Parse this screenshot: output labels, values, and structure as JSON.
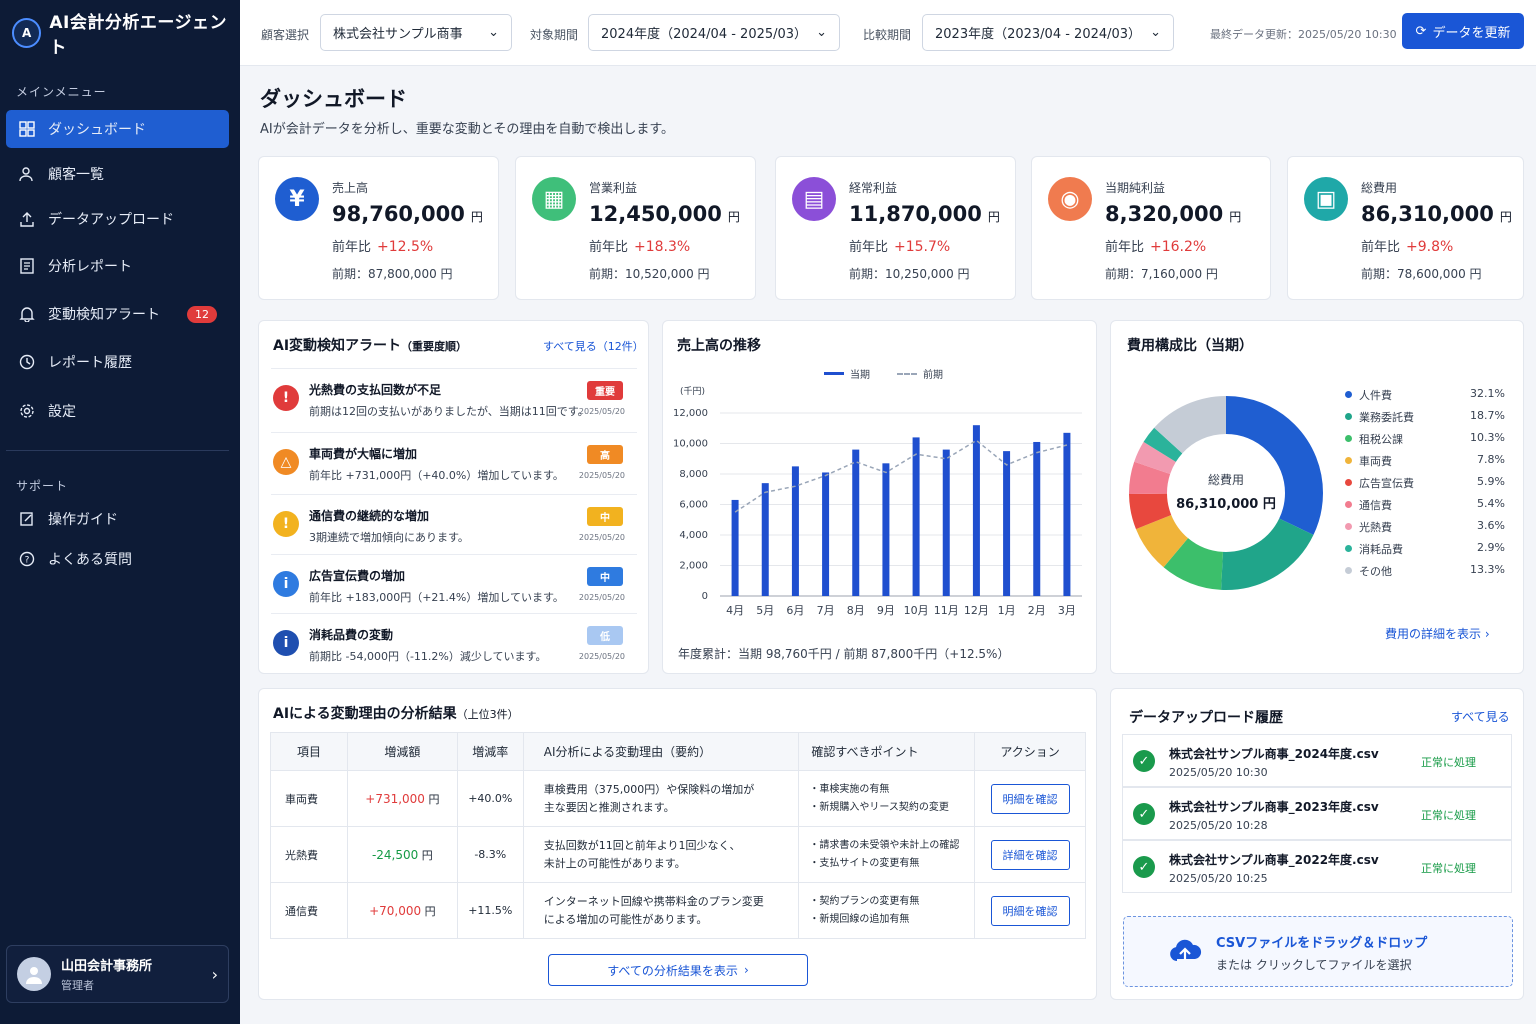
{
  "app": {
    "title": "AI会計分析エージェント",
    "logo_mark": "A"
  },
  "sidebar": {
    "main_section": "メインメニュー",
    "items": [
      {
        "label": "ダッシュボード",
        "icon": "dashboard-icon",
        "active": true
      },
      {
        "label": "顧客一覧",
        "icon": "users-icon"
      },
      {
        "label": "データアップロード",
        "icon": "upload-icon"
      },
      {
        "label": "分析レポート",
        "icon": "report-icon"
      },
      {
        "label": "変動検知アラート",
        "icon": "bell-icon",
        "badge": "12"
      },
      {
        "label": "レポート履歴",
        "icon": "history-icon"
      },
      {
        "label": "設定",
        "icon": "gear-icon"
      }
    ],
    "support_section": "サポート",
    "support_items": [
      {
        "label": "操作ガイド",
        "icon": "guide-icon"
      },
      {
        "label": "よくある質問",
        "icon": "help-icon"
      }
    ],
    "user": {
      "name": "山田会計事務所",
      "role": "管理者"
    }
  },
  "topbar": {
    "client_label": "顧客選択",
    "client_value": "株式会社サンプル商事",
    "period_label": "対象期間",
    "period_value": "2024年度（2024/04 - 2025/03）",
    "compare_label": "比較期間",
    "compare_value": "2023年度（2023/04 - 2024/03）",
    "last_updated": "最終データ更新：2025/05/20 10:30",
    "refresh_label": "データを更新"
  },
  "page": {
    "title": "ダッシュボード",
    "subtitle": "AIが会計データを分析し、重要な変動とその理由を自動で検出します。"
  },
  "kpis": [
    {
      "title": "売上高",
      "value": "98,760,000",
      "unit": "円",
      "yoy_label": "前年比",
      "yoy": "+12.5%",
      "prev": "前期：87,800,000 円",
      "color": "#1f5ed1",
      "icon": "yen-icon",
      "glyph": "¥"
    },
    {
      "title": "営業利益",
      "value": "12,450,000",
      "unit": "円",
      "yoy_label": "前年比",
      "yoy": "+18.3%",
      "prev": "前期：10,520,000 円",
      "color": "#3fbf7a",
      "icon": "building-icon",
      "glyph": "▦"
    },
    {
      "title": "経常利益",
      "value": "11,870,000",
      "unit": "円",
      "yoy_label": "前年比",
      "yoy": "+15.7%",
      "prev": "前期：10,250,000 円",
      "color": "#8b4fd8",
      "icon": "chart-icon",
      "glyph": "▤"
    },
    {
      "title": "当期純利益",
      "value": "8,320,000",
      "unit": "円",
      "yoy_label": "前年比",
      "yoy": "+16.2%",
      "prev": "前期：7,160,000 円",
      "color": "#f07b4f",
      "icon": "money-bag-icon",
      "glyph": "◉"
    },
    {
      "title": "総費用",
      "value": "86,310,000",
      "unit": "円",
      "yoy_label": "前年比",
      "yoy": "+9.8%",
      "prev": "前期：78,600,000 円",
      "color": "#1fa8a8",
      "icon": "receipt-icon",
      "glyph": "▣"
    }
  ],
  "alerts": {
    "title": "AI変動検知アラート",
    "title_sub": "（重要度順）",
    "view_all": "すべて見る（12件）",
    "items": [
      {
        "title": "光熱費の支払回数が不足",
        "desc": "前期は12回の支払いがありましたが、当期は11回です。",
        "badge": "重要",
        "badge_color": "#e03b3b",
        "date": "2025/05/20",
        "icon_color": "#e03b3b",
        "glyph": "!",
        "icon": "error-icon"
      },
      {
        "title": "車両費が大幅に増加",
        "desc": "前年比 +731,000円（+40.0%）増加しています。",
        "badge": "高",
        "badge_color": "#f08a24",
        "date": "2025/05/20",
        "icon_color": "#f08a24",
        "glyph": "△",
        "icon": "warning-icon"
      },
      {
        "title": "通信費の継続的な増加",
        "desc": "3期連続で増加傾向にあります。",
        "badge": "中",
        "badge_color": "#f2b21f",
        "date": "2025/05/20",
        "icon_color": "#f2b21f",
        "glyph": "!",
        "icon": "caution-icon"
      },
      {
        "title": "広告宣伝費の増加",
        "desc": "前年比 +183,000円（+21.4%）増加しています。",
        "badge": "中",
        "badge_color": "#2f7be0",
        "date": "2025/05/20",
        "icon_color": "#2f7be0",
        "glyph": "i",
        "icon": "info-icon"
      },
      {
        "title": "消耗品費の変動",
        "desc": "前期比 -54,000円（-11.2%）減少しています。",
        "badge": "低",
        "badge_color": "#a9c8f2",
        "date": "2025/05/20",
        "icon_color": "#1f4fb0",
        "glyph": "i",
        "icon": "info-icon"
      }
    ]
  },
  "sales_chart": {
    "title": "売上高の推移",
    "legend_current": "当期",
    "legend_prev": "前期",
    "total_text": "年度累計：当期 98,760千円 / 前期 87,800千円（+12.5%）"
  },
  "chart_data": [
    {
      "type": "bar",
      "title": "売上高の推移",
      "ylabel": "(千円)",
      "ylim": [
        0,
        12000
      ],
      "yticks": [
        "0",
        "2,000",
        "4,000",
        "6,000",
        "8,000",
        "10,000",
        "12,000"
      ],
      "categories": [
        "4月",
        "5月",
        "6月",
        "7月",
        "8月",
        "9月",
        "10月",
        "11月",
        "12月",
        "1月",
        "2月",
        "3月"
      ],
      "series": [
        {
          "name": "当期",
          "type": "bar",
          "color": "#1f4fcf",
          "values": [
            6300,
            7400,
            8500,
            8100,
            9600,
            8700,
            10400,
            9600,
            11200,
            9500,
            10100,
            10700
          ]
        },
        {
          "name": "前期",
          "type": "line",
          "style": "dashed",
          "color": "#9aa6b8",
          "values": [
            5500,
            6800,
            7200,
            7900,
            8800,
            8100,
            9300,
            9000,
            10200,
            8600,
            9400,
            9900
          ]
        }
      ],
      "grid": true,
      "legend": "top-center"
    },
    {
      "type": "pie",
      "title": "費用構成比（当期）",
      "center_label": "総費用",
      "center_value": "86,310,000 円",
      "slices": [
        {
          "name": "人件費",
          "pct": "32.1%",
          "value": 32.1,
          "color": "#1f5ed1"
        },
        {
          "name": "業務委託費",
          "pct": "18.7%",
          "value": 18.7,
          "color": "#20a58a"
        },
        {
          "name": "租税公課",
          "pct": "10.3%",
          "value": 10.3,
          "color": "#3cbf6b"
        },
        {
          "name": "車両費",
          "pct": "7.8%",
          "value": 7.8,
          "color": "#f0b43a"
        },
        {
          "name": "広告宣伝費",
          "pct": "5.9%",
          "value": 5.9,
          "color": "#e8483e"
        },
        {
          "name": "通信費",
          "pct": "5.4%",
          "value": 5.4,
          "color": "#f27c8f"
        },
        {
          "name": "光熱費",
          "pct": "3.6%",
          "value": 3.6,
          "color": "#f29ab0"
        },
        {
          "name": "消耗品費",
          "pct": "2.9%",
          "value": 2.9,
          "color": "#2bb39b"
        },
        {
          "name": "その他",
          "pct": "13.3%",
          "value": 13.3,
          "color": "#c5ccd6"
        }
      ],
      "legend": "right"
    }
  ],
  "cost_chart": {
    "title": "費用構成比（当期）",
    "detail_link": "費用の詳細を表示"
  },
  "analysis": {
    "title": "AIによる変動理由の分析結果",
    "title_sub": "（上位3件）",
    "headers": [
      "項目",
      "増減額",
      "増減率",
      "AI分析による変動理由（要約）",
      "確認すべきポイント",
      "アクション"
    ],
    "rows": [
      {
        "item": "車両費",
        "amount": "+731,000",
        "unit": "円",
        "rate": "+40.0%",
        "trend": "up",
        "reason1": "車検費用（375,000円）や保険料の増加が",
        "reason2": "主な要因と推測されます。",
        "point1": "・車検実施の有無",
        "point2": "・新規購入やリース契約の変更",
        "action": "明細を確認"
      },
      {
        "item": "光熱費",
        "amount": "-24,500",
        "unit": "円",
        "rate": "-8.3%",
        "trend": "down",
        "reason1": "支払回数が11回と前年より1回少なく、",
        "reason2": "未計上の可能性があります。",
        "point1": "・請求書の未受領や未計上の確認",
        "point2": "・支払サイトの変更有無",
        "action": "詳細を確認"
      },
      {
        "item": "通信費",
        "amount": "+70,000",
        "unit": "円",
        "rate": "+11.5%",
        "trend": "up",
        "reason1": "インターネット回線や携帯料金のプラン変更",
        "reason2": "による増加の可能性があります。",
        "point1": "・契約プランの変更有無",
        "point2": "・新規回線の追加有無",
        "action": "明細を確認"
      }
    ],
    "show_all": "すべての分析結果を表示"
  },
  "uploads": {
    "title": "データアップロード履歴",
    "view_all": "すべて見る",
    "items": [
      {
        "file": "株式会社サンプル商事_2024年度.csv",
        "time": "2025/05/20 10:30",
        "status": "正常に処理"
      },
      {
        "file": "株式会社サンプル商事_2023年度.csv",
        "time": "2025/05/20 10:28",
        "status": "正常に処理"
      },
      {
        "file": "株式会社サンプル商事_2022年度.csv",
        "time": "2025/05/20 10:25",
        "status": "正常に処理"
      }
    ],
    "drop_title": "CSVファイルをドラッグ＆ドロップ",
    "drop_sub": "または クリックしてファイルを選択"
  }
}
